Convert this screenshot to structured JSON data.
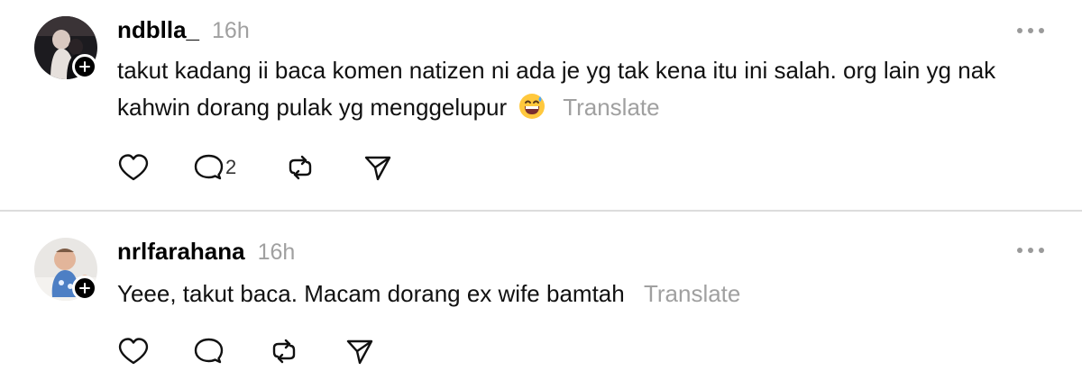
{
  "posts": [
    {
      "username": "ndblla_",
      "time": "16h",
      "text": "takut kadang ii baca komen natizen ni ada je yg tak kena itu ini salah. org lain yg nak kahwin dorang pulak yg menggelupur",
      "emoji": "grinning-sweat-emoji",
      "translate_label": "Translate",
      "reply_count": "2"
    },
    {
      "username": "nrlfarahana",
      "time": "16h",
      "text": "Yeee, takut baca. Macam dorang ex wife bamtah",
      "translate_label": "Translate",
      "reply_count": ""
    }
  ],
  "icons": [
    "heart-icon",
    "comment-icon",
    "repost-icon",
    "share-icon",
    "more-icon",
    "plus-icon"
  ],
  "colors": {
    "muted": "#a0a0a0",
    "divider": "#dcdcdc",
    "badge": "#000000"
  }
}
